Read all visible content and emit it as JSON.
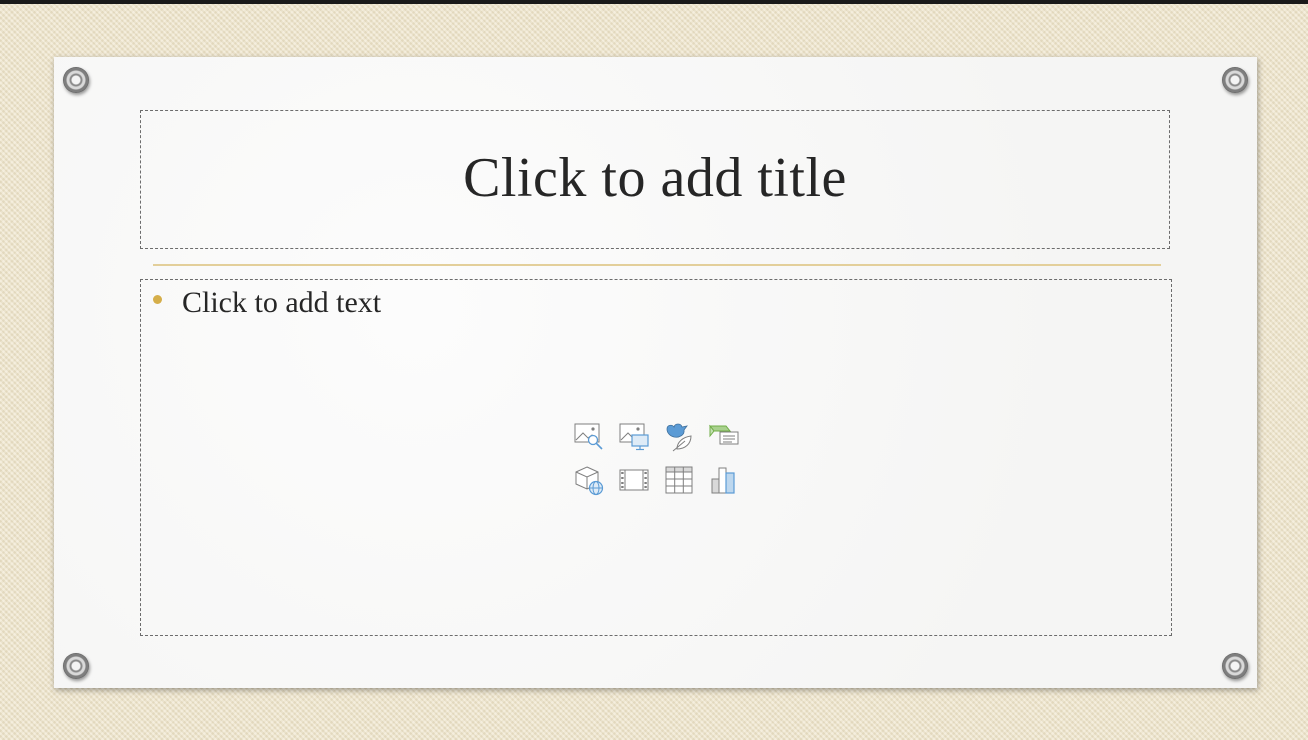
{
  "slide": {
    "title_placeholder": "Click to add title",
    "content_placeholder": "Click to add text"
  },
  "insert_icons": [
    "pictures-icon",
    "online-pictures-icon",
    "icons-insert-icon",
    "smartart-icon",
    "3d-models-icon",
    "video-icon",
    "table-icon",
    "chart-icon"
  ],
  "colors": {
    "background": "#efe4c8",
    "slide": "#f8f8f7",
    "accent_line": "#e3cf9a",
    "bullet": "#d5ae4a",
    "text": "#262626",
    "icon_blue": "#5b9bd5",
    "icon_green": "#70ad47"
  }
}
